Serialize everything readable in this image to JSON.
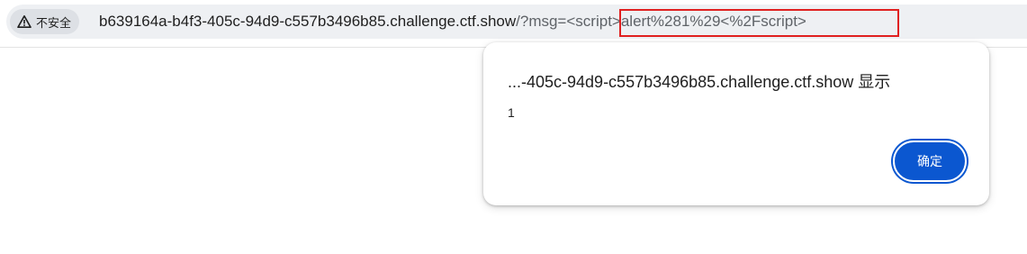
{
  "address_bar": {
    "security_label": "不安全",
    "security_icon": "warning-triangle-icon",
    "url_host": "b639164a-b4f3-405c-94d9-c557b3496b85.challenge.ctf.show",
    "url_path": "/?msg=",
    "url_payload": "<script>alert%281%29<%2Fscript>"
  },
  "alert_dialog": {
    "title": "...-405c-94d9-c557b3496b85.challenge.ctf.show 显示",
    "message": "1",
    "ok_label": "确定"
  },
  "colors": {
    "highlight": "#e02020",
    "button": "#0b57d0"
  }
}
